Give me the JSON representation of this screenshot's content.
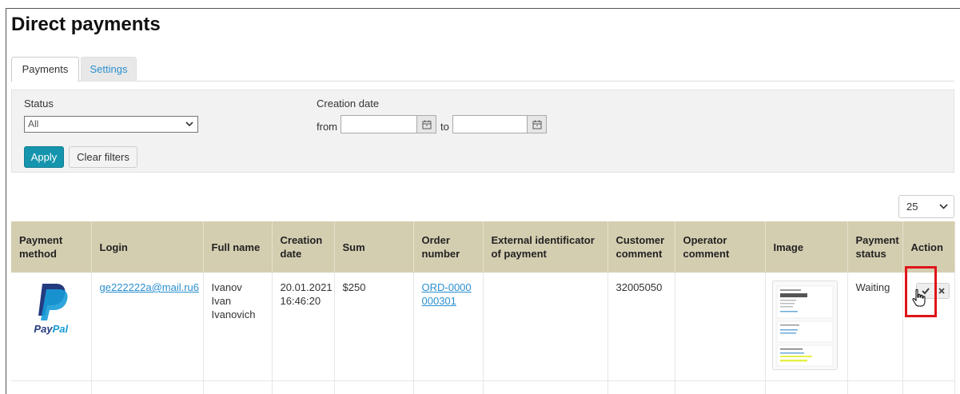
{
  "page_title": "Direct payments",
  "tabs": [
    {
      "label": "Payments",
      "active": true
    },
    {
      "label": "Settings",
      "active": false
    }
  ],
  "filters": {
    "status_label": "Status",
    "status_value": "All",
    "creation_date_label": "Creation date",
    "from_label": "from",
    "to_label": "to",
    "from_value": "",
    "to_value": "",
    "apply_label": "Apply",
    "clear_label": "Clear filters"
  },
  "per_page": "25",
  "table": {
    "columns": [
      "Payment method",
      "Login",
      "Full name",
      "Creation date",
      "Sum",
      "Order number",
      "External identificator of payment",
      "Customer comment",
      "Operator comment",
      "Image",
      "Payment status",
      "Action"
    ],
    "rows": [
      {
        "payment_method": "PayPal",
        "login": "ge222222a@mail.ru6",
        "full_name": "Ivanov Ivan Ivanovich",
        "creation_date": "20.01.2021 16:46:20",
        "sum": "$250",
        "order_number": "ORD-0000000301",
        "external_id": "",
        "customer_comment": "32005050",
        "operator_comment": "",
        "payment_status": "Waiting"
      }
    ]
  },
  "colors": {
    "header_bg": "#d4ceb1",
    "link": "#2a8fcf",
    "apply_button": "#1595ad",
    "highlight": "#e0141a"
  },
  "icons": {
    "calendar": "calendar-icon",
    "approve": "check-icon",
    "reject": "close-icon",
    "cursor": "hand-cursor-icon"
  }
}
